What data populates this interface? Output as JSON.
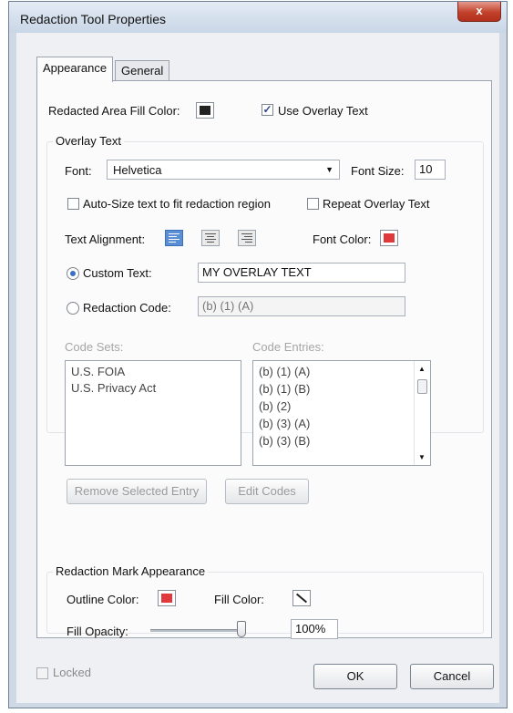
{
  "window": {
    "title": "Redaction Tool Properties",
    "close_glyph": "x"
  },
  "tabs": [
    {
      "label": "Appearance",
      "active": true
    },
    {
      "label": "General",
      "active": false
    }
  ],
  "appearance": {
    "fill_color_label": "Redacted Area Fill Color:",
    "fill_color": "#222222",
    "use_overlay_label": "Use Overlay Text",
    "use_overlay_checked": true,
    "overlay_group_label": "Overlay Text",
    "font_label": "Font:",
    "font_value": "Helvetica",
    "font_size_label": "Font Size:",
    "font_size_value": "10",
    "autosize_label": "Auto-Size text to fit redaction region",
    "autosize_checked": false,
    "repeat_label": "Repeat Overlay Text",
    "repeat_checked": false,
    "text_alignment_label": "Text Alignment:",
    "alignment_selected": "left",
    "font_color_label": "Font Color:",
    "font_color": "#e0393b",
    "custom_text_label": "Custom Text:",
    "custom_text_value": "MY OVERLAY TEXT",
    "redaction_code_label": "Redaction Code:",
    "redaction_code_value": "(b) (1) (A)",
    "selected_radio": "custom_text",
    "code_sets_label": "Code Sets:",
    "code_sets": [
      "U.S. FOIA",
      "U.S. Privacy Act"
    ],
    "code_entries_label": "Code Entries:",
    "code_entries": [
      "(b) (1) (A)",
      "(b) (1) (B)",
      "(b) (2)",
      "(b) (3) (A)",
      "(b) (3) (B)"
    ],
    "remove_entry_label": "Remove Selected Entry",
    "edit_codes_label": "Edit Codes",
    "mark_group_label": "Redaction Mark Appearance",
    "outline_color_label": "Outline Color:",
    "outline_color": "#e0393b",
    "fill_color2_label": "Fill Color:",
    "fill_opacity_label": "Fill Opacity:",
    "fill_opacity_value": "100%",
    "fill_opacity_fraction": 1.0
  },
  "footer": {
    "locked_label": "Locked",
    "locked_checked": false,
    "ok_label": "OK",
    "cancel_label": "Cancel"
  },
  "icons": {
    "checkmark": "✓",
    "scroll_up": "▲",
    "scroll_down": "▼",
    "dropdown": "▼"
  }
}
